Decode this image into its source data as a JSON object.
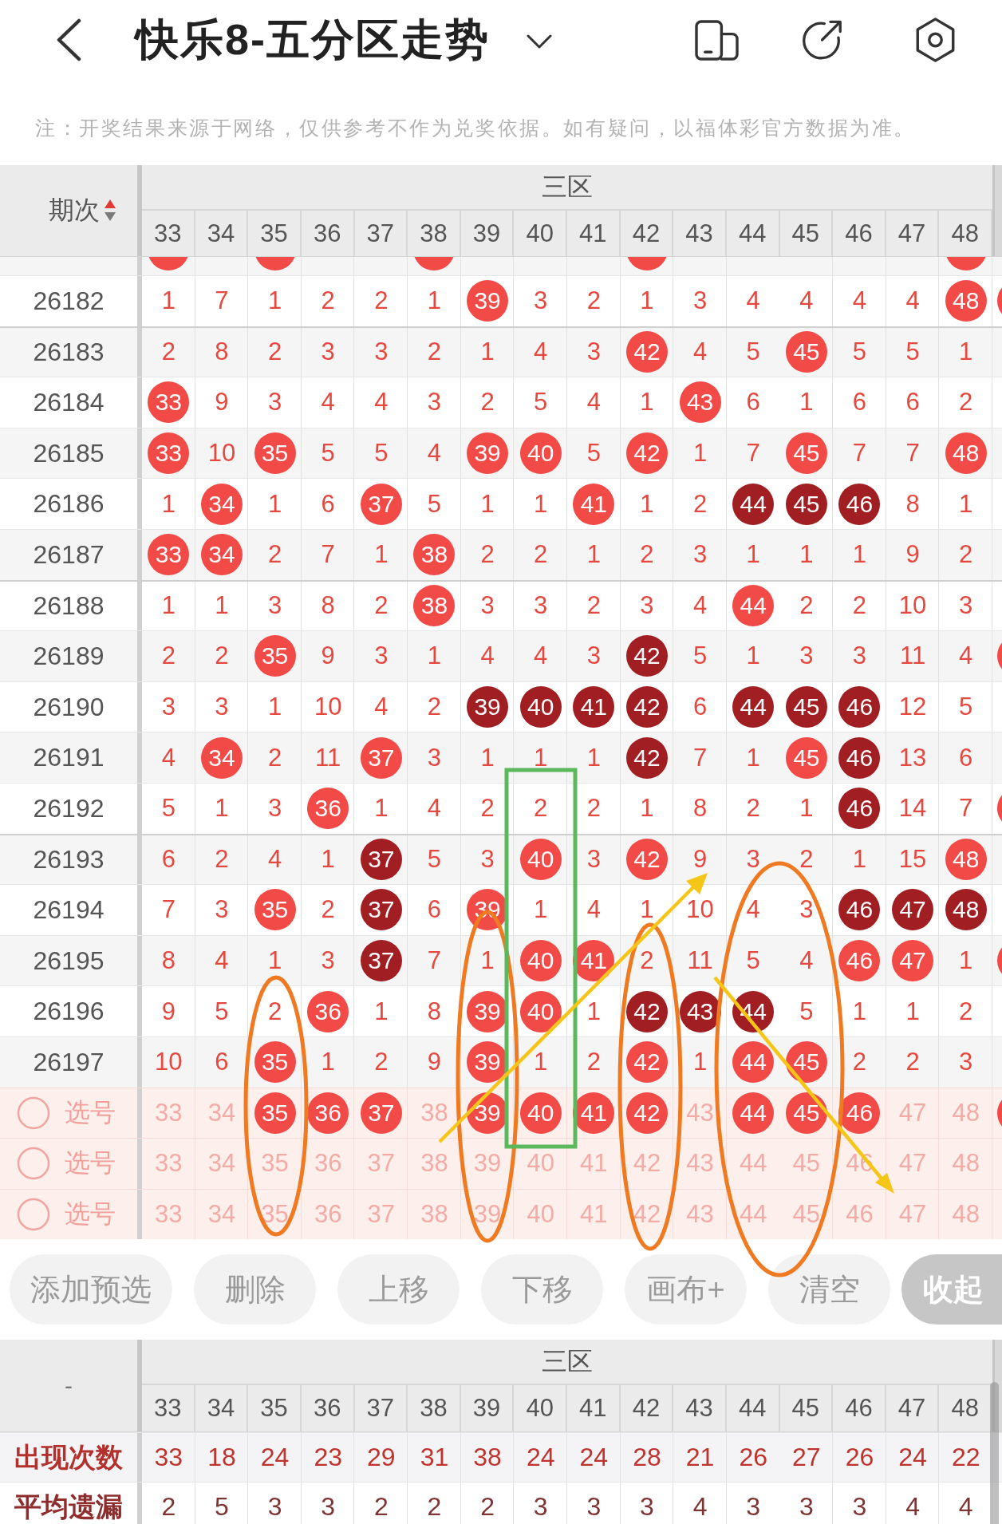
{
  "header": {
    "title": "快乐8-五分区走势"
  },
  "notice": "注：开奖结果来源于网络，仅供参考不作为兑奖依据。如有疑问，以福体彩官方数据为准。",
  "trend_table": {
    "issue_header": "期次",
    "sorted_up": true,
    "zone_label": "三区",
    "columns": [
      "33",
      "34",
      "35",
      "36",
      "37",
      "38",
      "39",
      "40",
      "41",
      "42",
      "43",
      "44",
      "45",
      "46",
      "47",
      "48"
    ],
    "partial_row": {
      "hits": [
        true,
        false,
        true,
        false,
        false,
        true,
        false,
        false,
        false,
        true,
        false,
        false,
        false,
        false,
        false,
        true
      ]
    },
    "rows": [
      {
        "issue": "26182",
        "next_hit": true,
        "cells": [
          {
            "text": "1",
            "kind": "miss"
          },
          {
            "text": "7",
            "kind": "miss"
          },
          {
            "text": "1",
            "kind": "miss"
          },
          {
            "text": "2",
            "kind": "miss"
          },
          {
            "text": "2",
            "kind": "miss"
          },
          {
            "text": "1",
            "kind": "miss"
          },
          {
            "text": "39",
            "kind": "hit"
          },
          {
            "text": "3",
            "kind": "miss"
          },
          {
            "text": "2",
            "kind": "miss"
          },
          {
            "text": "1",
            "kind": "miss"
          },
          {
            "text": "3",
            "kind": "miss"
          },
          {
            "text": "4",
            "kind": "miss"
          },
          {
            "text": "4",
            "kind": "miss"
          },
          {
            "text": "4",
            "kind": "miss"
          },
          {
            "text": "4",
            "kind": "miss"
          },
          {
            "text": "48",
            "kind": "hit"
          }
        ]
      },
      {
        "issue": "26183",
        "next_hit": false,
        "cells": [
          {
            "text": "2",
            "kind": "miss"
          },
          {
            "text": "8",
            "kind": "miss"
          },
          {
            "text": "2",
            "kind": "miss"
          },
          {
            "text": "3",
            "kind": "miss"
          },
          {
            "text": "3",
            "kind": "miss"
          },
          {
            "text": "2",
            "kind": "miss"
          },
          {
            "text": "1",
            "kind": "miss"
          },
          {
            "text": "4",
            "kind": "miss"
          },
          {
            "text": "3",
            "kind": "miss"
          },
          {
            "text": "42",
            "kind": "hit"
          },
          {
            "text": "4",
            "kind": "miss"
          },
          {
            "text": "5",
            "kind": "miss"
          },
          {
            "text": "45",
            "kind": "hit"
          },
          {
            "text": "5",
            "kind": "miss"
          },
          {
            "text": "5",
            "kind": "miss"
          },
          {
            "text": "1",
            "kind": "miss"
          }
        ]
      },
      {
        "issue": "26184",
        "next_hit": false,
        "cells": [
          {
            "text": "33",
            "kind": "hit"
          },
          {
            "text": "9",
            "kind": "miss"
          },
          {
            "text": "3",
            "kind": "miss"
          },
          {
            "text": "4",
            "kind": "miss"
          },
          {
            "text": "4",
            "kind": "miss"
          },
          {
            "text": "3",
            "kind": "miss"
          },
          {
            "text": "2",
            "kind": "miss"
          },
          {
            "text": "5",
            "kind": "miss"
          },
          {
            "text": "4",
            "kind": "miss"
          },
          {
            "text": "1",
            "kind": "miss"
          },
          {
            "text": "43",
            "kind": "hit"
          },
          {
            "text": "6",
            "kind": "miss"
          },
          {
            "text": "1",
            "kind": "miss"
          },
          {
            "text": "6",
            "kind": "miss"
          },
          {
            "text": "6",
            "kind": "miss"
          },
          {
            "text": "2",
            "kind": "miss"
          }
        ]
      },
      {
        "issue": "26185",
        "next_hit": false,
        "cells": [
          {
            "text": "33",
            "kind": "hit"
          },
          {
            "text": "10",
            "kind": "miss"
          },
          {
            "text": "35",
            "kind": "hit"
          },
          {
            "text": "5",
            "kind": "miss"
          },
          {
            "text": "5",
            "kind": "miss"
          },
          {
            "text": "4",
            "kind": "miss"
          },
          {
            "text": "39",
            "kind": "hit"
          },
          {
            "text": "40",
            "kind": "hit"
          },
          {
            "text": "5",
            "kind": "miss"
          },
          {
            "text": "42",
            "kind": "hit"
          },
          {
            "text": "1",
            "kind": "miss"
          },
          {
            "text": "7",
            "kind": "miss"
          },
          {
            "text": "45",
            "kind": "hit"
          },
          {
            "text": "7",
            "kind": "miss"
          },
          {
            "text": "7",
            "kind": "miss"
          },
          {
            "text": "48",
            "kind": "hit"
          }
        ]
      },
      {
        "issue": "26186",
        "next_hit": false,
        "cells": [
          {
            "text": "1",
            "kind": "miss"
          },
          {
            "text": "34",
            "kind": "hit"
          },
          {
            "text": "1",
            "kind": "miss"
          },
          {
            "text": "6",
            "kind": "miss"
          },
          {
            "text": "37",
            "kind": "hit"
          },
          {
            "text": "5",
            "kind": "miss"
          },
          {
            "text": "1",
            "kind": "miss"
          },
          {
            "text": "1",
            "kind": "miss"
          },
          {
            "text": "41",
            "kind": "hit"
          },
          {
            "text": "1",
            "kind": "miss"
          },
          {
            "text": "2",
            "kind": "miss"
          },
          {
            "text": "44",
            "kind": "dark_hit"
          },
          {
            "text": "45",
            "kind": "dark_hit"
          },
          {
            "text": "46",
            "kind": "dark_hit"
          },
          {
            "text": "8",
            "kind": "miss"
          },
          {
            "text": "1",
            "kind": "miss"
          }
        ]
      },
      {
        "issue": "26187",
        "next_hit": false,
        "cells": [
          {
            "text": "33",
            "kind": "hit"
          },
          {
            "text": "34",
            "kind": "hit"
          },
          {
            "text": "2",
            "kind": "miss"
          },
          {
            "text": "7",
            "kind": "miss"
          },
          {
            "text": "1",
            "kind": "miss"
          },
          {
            "text": "38",
            "kind": "hit"
          },
          {
            "text": "2",
            "kind": "miss"
          },
          {
            "text": "2",
            "kind": "miss"
          },
          {
            "text": "1",
            "kind": "miss"
          },
          {
            "text": "2",
            "kind": "miss"
          },
          {
            "text": "3",
            "kind": "miss"
          },
          {
            "text": "1",
            "kind": "miss"
          },
          {
            "text": "1",
            "kind": "miss"
          },
          {
            "text": "1",
            "kind": "miss"
          },
          {
            "text": "9",
            "kind": "miss"
          },
          {
            "text": "2",
            "kind": "miss"
          }
        ]
      },
      {
        "issue": "26188",
        "next_hit": false,
        "cells": [
          {
            "text": "1",
            "kind": "miss"
          },
          {
            "text": "1",
            "kind": "miss"
          },
          {
            "text": "3",
            "kind": "miss"
          },
          {
            "text": "8",
            "kind": "miss"
          },
          {
            "text": "2",
            "kind": "miss"
          },
          {
            "text": "38",
            "kind": "hit"
          },
          {
            "text": "3",
            "kind": "miss"
          },
          {
            "text": "3",
            "kind": "miss"
          },
          {
            "text": "2",
            "kind": "miss"
          },
          {
            "text": "3",
            "kind": "miss"
          },
          {
            "text": "4",
            "kind": "miss"
          },
          {
            "text": "44",
            "kind": "hit"
          },
          {
            "text": "2",
            "kind": "miss"
          },
          {
            "text": "2",
            "kind": "miss"
          },
          {
            "text": "10",
            "kind": "miss"
          },
          {
            "text": "3",
            "kind": "miss"
          }
        ]
      },
      {
        "issue": "26189",
        "next_hit": true,
        "cells": [
          {
            "text": "2",
            "kind": "miss"
          },
          {
            "text": "2",
            "kind": "miss"
          },
          {
            "text": "35",
            "kind": "hit"
          },
          {
            "text": "9",
            "kind": "miss"
          },
          {
            "text": "3",
            "kind": "miss"
          },
          {
            "text": "1",
            "kind": "miss"
          },
          {
            "text": "4",
            "kind": "miss"
          },
          {
            "text": "4",
            "kind": "miss"
          },
          {
            "text": "3",
            "kind": "miss"
          },
          {
            "text": "42",
            "kind": "dark_hit"
          },
          {
            "text": "5",
            "kind": "miss"
          },
          {
            "text": "1",
            "kind": "miss"
          },
          {
            "text": "3",
            "kind": "miss"
          },
          {
            "text": "3",
            "kind": "miss"
          },
          {
            "text": "11",
            "kind": "miss"
          },
          {
            "text": "4",
            "kind": "miss"
          }
        ]
      },
      {
        "issue": "26190",
        "next_hit": false,
        "cells": [
          {
            "text": "3",
            "kind": "miss"
          },
          {
            "text": "3",
            "kind": "miss"
          },
          {
            "text": "1",
            "kind": "miss"
          },
          {
            "text": "10",
            "kind": "miss"
          },
          {
            "text": "4",
            "kind": "miss"
          },
          {
            "text": "2",
            "kind": "miss"
          },
          {
            "text": "39",
            "kind": "dark_hit"
          },
          {
            "text": "40",
            "kind": "dark_hit"
          },
          {
            "text": "41",
            "kind": "dark_hit"
          },
          {
            "text": "42",
            "kind": "dark_hit"
          },
          {
            "text": "6",
            "kind": "miss"
          },
          {
            "text": "44",
            "kind": "dark_hit"
          },
          {
            "text": "45",
            "kind": "dark_hit"
          },
          {
            "text": "46",
            "kind": "dark_hit"
          },
          {
            "text": "12",
            "kind": "miss"
          },
          {
            "text": "5",
            "kind": "miss"
          }
        ]
      },
      {
        "issue": "26191",
        "next_hit": false,
        "cells": [
          {
            "text": "4",
            "kind": "miss"
          },
          {
            "text": "34",
            "kind": "hit"
          },
          {
            "text": "2",
            "kind": "miss"
          },
          {
            "text": "11",
            "kind": "miss"
          },
          {
            "text": "37",
            "kind": "hit"
          },
          {
            "text": "3",
            "kind": "miss"
          },
          {
            "text": "1",
            "kind": "miss"
          },
          {
            "text": "1",
            "kind": "miss"
          },
          {
            "text": "1",
            "kind": "miss"
          },
          {
            "text": "42",
            "kind": "dark_hit"
          },
          {
            "text": "7",
            "kind": "miss"
          },
          {
            "text": "1",
            "kind": "miss"
          },
          {
            "text": "45",
            "kind": "hit"
          },
          {
            "text": "46",
            "kind": "dark_hit"
          },
          {
            "text": "13",
            "kind": "miss"
          },
          {
            "text": "6",
            "kind": "miss"
          }
        ]
      },
      {
        "issue": "26192",
        "next_hit": true,
        "cells": [
          {
            "text": "5",
            "kind": "miss"
          },
          {
            "text": "1",
            "kind": "miss"
          },
          {
            "text": "3",
            "kind": "miss"
          },
          {
            "text": "36",
            "kind": "hit"
          },
          {
            "text": "1",
            "kind": "miss"
          },
          {
            "text": "4",
            "kind": "miss"
          },
          {
            "text": "2",
            "kind": "miss"
          },
          {
            "text": "2",
            "kind": "miss"
          },
          {
            "text": "2",
            "kind": "miss"
          },
          {
            "text": "1",
            "kind": "miss"
          },
          {
            "text": "8",
            "kind": "miss"
          },
          {
            "text": "2",
            "kind": "miss"
          },
          {
            "text": "1",
            "kind": "miss"
          },
          {
            "text": "46",
            "kind": "dark_hit"
          },
          {
            "text": "14",
            "kind": "miss"
          },
          {
            "text": "7",
            "kind": "miss"
          }
        ]
      },
      {
        "issue": "26193",
        "next_hit": false,
        "cells": [
          {
            "text": "6",
            "kind": "miss"
          },
          {
            "text": "2",
            "kind": "miss"
          },
          {
            "text": "4",
            "kind": "miss"
          },
          {
            "text": "1",
            "kind": "miss"
          },
          {
            "text": "37",
            "kind": "dark_hit"
          },
          {
            "text": "5",
            "kind": "miss"
          },
          {
            "text": "3",
            "kind": "miss"
          },
          {
            "text": "40",
            "kind": "hit"
          },
          {
            "text": "3",
            "kind": "miss"
          },
          {
            "text": "42",
            "kind": "hit"
          },
          {
            "text": "9",
            "kind": "miss"
          },
          {
            "text": "3",
            "kind": "miss"
          },
          {
            "text": "2",
            "kind": "miss"
          },
          {
            "text": "1",
            "kind": "miss"
          },
          {
            "text": "15",
            "kind": "miss"
          },
          {
            "text": "48",
            "kind": "hit"
          }
        ]
      },
      {
        "issue": "26194",
        "next_hit": false,
        "cells": [
          {
            "text": "7",
            "kind": "miss"
          },
          {
            "text": "3",
            "kind": "miss"
          },
          {
            "text": "35",
            "kind": "hit"
          },
          {
            "text": "2",
            "kind": "miss"
          },
          {
            "text": "37",
            "kind": "dark_hit"
          },
          {
            "text": "6",
            "kind": "miss"
          },
          {
            "text": "39",
            "kind": "hit"
          },
          {
            "text": "1",
            "kind": "miss"
          },
          {
            "text": "4",
            "kind": "miss"
          },
          {
            "text": "1",
            "kind": "miss"
          },
          {
            "text": "10",
            "kind": "miss"
          },
          {
            "text": "4",
            "kind": "miss"
          },
          {
            "text": "3",
            "kind": "miss"
          },
          {
            "text": "46",
            "kind": "dark_hit"
          },
          {
            "text": "47",
            "kind": "dark_hit"
          },
          {
            "text": "48",
            "kind": "dark_hit"
          }
        ]
      },
      {
        "issue": "26195",
        "next_hit": true,
        "cells": [
          {
            "text": "8",
            "kind": "miss"
          },
          {
            "text": "4",
            "kind": "miss"
          },
          {
            "text": "1",
            "kind": "miss"
          },
          {
            "text": "3",
            "kind": "miss"
          },
          {
            "text": "37",
            "kind": "dark_hit"
          },
          {
            "text": "7",
            "kind": "miss"
          },
          {
            "text": "1",
            "kind": "miss"
          },
          {
            "text": "40",
            "kind": "hit"
          },
          {
            "text": "41",
            "kind": "hit"
          },
          {
            "text": "2",
            "kind": "miss"
          },
          {
            "text": "11",
            "kind": "miss"
          },
          {
            "text": "5",
            "kind": "miss"
          },
          {
            "text": "4",
            "kind": "miss"
          },
          {
            "text": "46",
            "kind": "hit"
          },
          {
            "text": "47",
            "kind": "hit"
          },
          {
            "text": "1",
            "kind": "miss"
          }
        ]
      },
      {
        "issue": "26196",
        "next_hit": false,
        "cells": [
          {
            "text": "9",
            "kind": "miss"
          },
          {
            "text": "5",
            "kind": "miss"
          },
          {
            "text": "2",
            "kind": "miss"
          },
          {
            "text": "36",
            "kind": "hit"
          },
          {
            "text": "1",
            "kind": "miss"
          },
          {
            "text": "8",
            "kind": "miss"
          },
          {
            "text": "39",
            "kind": "hit"
          },
          {
            "text": "40",
            "kind": "hit"
          },
          {
            "text": "1",
            "kind": "miss"
          },
          {
            "text": "42",
            "kind": "dark_hit"
          },
          {
            "text": "43",
            "kind": "dark_hit"
          },
          {
            "text": "44",
            "kind": "dark_hit"
          },
          {
            "text": "5",
            "kind": "miss"
          },
          {
            "text": "1",
            "kind": "miss"
          },
          {
            "text": "1",
            "kind": "miss"
          },
          {
            "text": "2",
            "kind": "miss"
          }
        ]
      },
      {
        "issue": "26197",
        "next_hit": false,
        "cells": [
          {
            "text": "10",
            "kind": "miss"
          },
          {
            "text": "6",
            "kind": "miss"
          },
          {
            "text": "35",
            "kind": "hit"
          },
          {
            "text": "1",
            "kind": "miss"
          },
          {
            "text": "2",
            "kind": "miss"
          },
          {
            "text": "9",
            "kind": "miss"
          },
          {
            "text": "39",
            "kind": "hit"
          },
          {
            "text": "1",
            "kind": "miss"
          },
          {
            "text": "2",
            "kind": "miss"
          },
          {
            "text": "42",
            "kind": "hit"
          },
          {
            "text": "1",
            "kind": "miss"
          },
          {
            "text": "44",
            "kind": "hit"
          },
          {
            "text": "45",
            "kind": "hit"
          },
          {
            "text": "2",
            "kind": "miss"
          },
          {
            "text": "2",
            "kind": "miss"
          },
          {
            "text": "3",
            "kind": "miss"
          }
        ]
      }
    ],
    "pick_rows": [
      {
        "label": "选号",
        "selected": false,
        "next_hit": true,
        "cells": [
          {
            "text": "33",
            "picked": false
          },
          {
            "text": "34",
            "picked": false
          },
          {
            "text": "35",
            "picked": true
          },
          {
            "text": "36",
            "picked": true
          },
          {
            "text": "37",
            "picked": true
          },
          {
            "text": "38",
            "picked": false
          },
          {
            "text": "39",
            "picked": true
          },
          {
            "text": "40",
            "picked": true
          },
          {
            "text": "41",
            "picked": true
          },
          {
            "text": "42",
            "picked": true
          },
          {
            "text": "43",
            "picked": false
          },
          {
            "text": "44",
            "picked": true
          },
          {
            "text": "45",
            "picked": true
          },
          {
            "text": "46",
            "picked": true
          },
          {
            "text": "47",
            "picked": false
          },
          {
            "text": "48",
            "picked": false
          }
        ]
      },
      {
        "label": "选号",
        "selected": false,
        "next_hit": false,
        "cells": [
          {
            "text": "33",
            "picked": false
          },
          {
            "text": "34",
            "picked": false
          },
          {
            "text": "35",
            "picked": false
          },
          {
            "text": "36",
            "picked": false
          },
          {
            "text": "37",
            "picked": false
          },
          {
            "text": "38",
            "picked": false
          },
          {
            "text": "39",
            "picked": false
          },
          {
            "text": "40",
            "picked": false
          },
          {
            "text": "41",
            "picked": false
          },
          {
            "text": "42",
            "picked": false
          },
          {
            "text": "43",
            "picked": false
          },
          {
            "text": "44",
            "picked": false
          },
          {
            "text": "45",
            "picked": false
          },
          {
            "text": "46",
            "picked": false
          },
          {
            "text": "47",
            "picked": false
          },
          {
            "text": "48",
            "picked": false
          }
        ]
      },
      {
        "label": "选号",
        "selected": false,
        "next_hit": false,
        "cells": [
          {
            "text": "33",
            "picked": false
          },
          {
            "text": "34",
            "picked": false
          },
          {
            "text": "35",
            "picked": false
          },
          {
            "text": "36",
            "picked": false
          },
          {
            "text": "37",
            "picked": false
          },
          {
            "text": "38",
            "picked": false
          },
          {
            "text": "39",
            "picked": false
          },
          {
            "text": "40",
            "picked": false
          },
          {
            "text": "41",
            "picked": false
          },
          {
            "text": "42",
            "picked": false
          },
          {
            "text": "43",
            "picked": false
          },
          {
            "text": "44",
            "picked": false
          },
          {
            "text": "45",
            "picked": false
          },
          {
            "text": "46",
            "picked": false
          },
          {
            "text": "47",
            "picked": false
          },
          {
            "text": "48",
            "picked": false
          }
        ]
      }
    ]
  },
  "toolbar": {
    "buttons": [
      {
        "label": "添加预选",
        "kind": "action"
      },
      {
        "label": "删除",
        "kind": "action"
      },
      {
        "label": "上移",
        "kind": "action"
      },
      {
        "label": "下移",
        "kind": "action"
      },
      {
        "label": "画布+",
        "kind": "action"
      },
      {
        "label": "清空",
        "kind": "action"
      },
      {
        "label": "收起",
        "kind": "collapse"
      }
    ]
  },
  "stats_table": {
    "corner": "-",
    "zone_label": "三区",
    "columns": [
      "33",
      "34",
      "35",
      "36",
      "37",
      "38",
      "39",
      "40",
      "41",
      "42",
      "43",
      "44",
      "45",
      "46",
      "47",
      "48"
    ],
    "rows": [
      {
        "label": "出现次数",
        "kind": "count",
        "values": [
          "33",
          "18",
          "24",
          "23",
          "29",
          "31",
          "38",
          "24",
          "24",
          "28",
          "21",
          "26",
          "27",
          "26",
          "24",
          "22"
        ]
      },
      {
        "label": "平均遗漏",
        "kind": "average",
        "values": [
          "2",
          "5",
          "3",
          "3",
          "2",
          "2",
          "2",
          "3",
          "3",
          "3",
          "4",
          "3",
          "3",
          "3",
          "4",
          "4"
        ]
      }
    ]
  }
}
